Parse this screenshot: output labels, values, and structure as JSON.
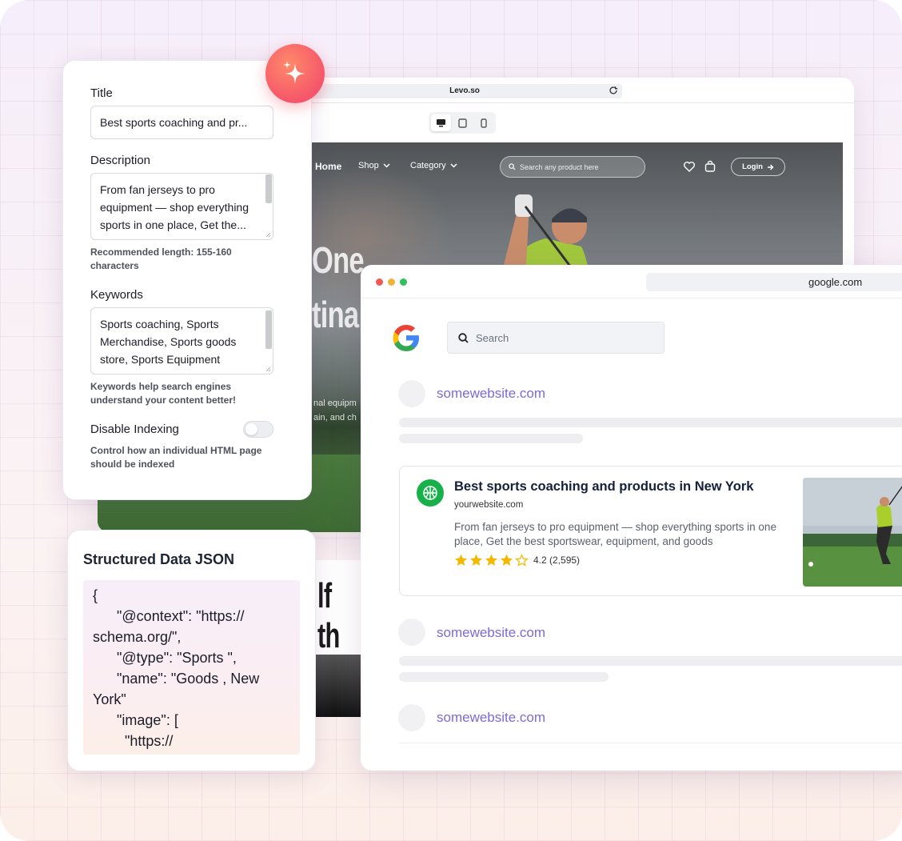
{
  "levo": {
    "url": "Levo.so",
    "nav": {
      "home": "Home",
      "shop": "Shop",
      "category": "Category"
    },
    "search_placeholder": "Search any product here",
    "login": "Login",
    "hero_line1": "One",
    "hero_line2": "tina",
    "hero_small1": "nal equipm",
    "hero_small2": "ain, and ch",
    "lower_text": "lf th"
  },
  "seo_panel": {
    "title_label": "Title",
    "title_value": "Best sports coaching and pr...",
    "description_label": "Description",
    "description_value": "From fan jerseys to pro equipment — shop everything sports in one place,  Get the...",
    "description_hint": "Recommended length: 155-160 characters",
    "keywords_label": "Keywords",
    "keywords_value": "Sports coaching, Sports Merchandise, Sports goods store, Sports Equipment",
    "keywords_hint": "Keywords help search engines understand your content better!",
    "indexing_label": "Disable Indexing",
    "indexing_enabled": false,
    "indexing_hint": "Control how an individual HTML page should be indexed"
  },
  "structured_data": {
    "title": "Structured Data JSON",
    "code": "{\n      \"@context\": \"https://\nschema.org/\",\n      \"@type\": \"Sports \",\n      \"name\": \"Goods , New\nYork\"\n      \"image\": [\n        \"https://"
  },
  "google": {
    "url": "google.com",
    "search_placeholder": "Search",
    "placeholder_site": "somewebsite.com",
    "result": {
      "title": "Best sports coaching and products in New York",
      "url": "yourwebsite.com",
      "description": "From fan jerseys to pro equipment — shop everything sports in one place,  Get the best sportswear, equipment, and goods",
      "rating_text": "4.2 (2,595)",
      "rating": 4.2
    },
    "colors": {
      "link": "#7b6bd8",
      "favicon": "#17b04a",
      "star": "#f5b800"
    }
  },
  "accent": {
    "sparkle_gradient": [
      "#ff8a6a",
      "#f5566a"
    ]
  }
}
